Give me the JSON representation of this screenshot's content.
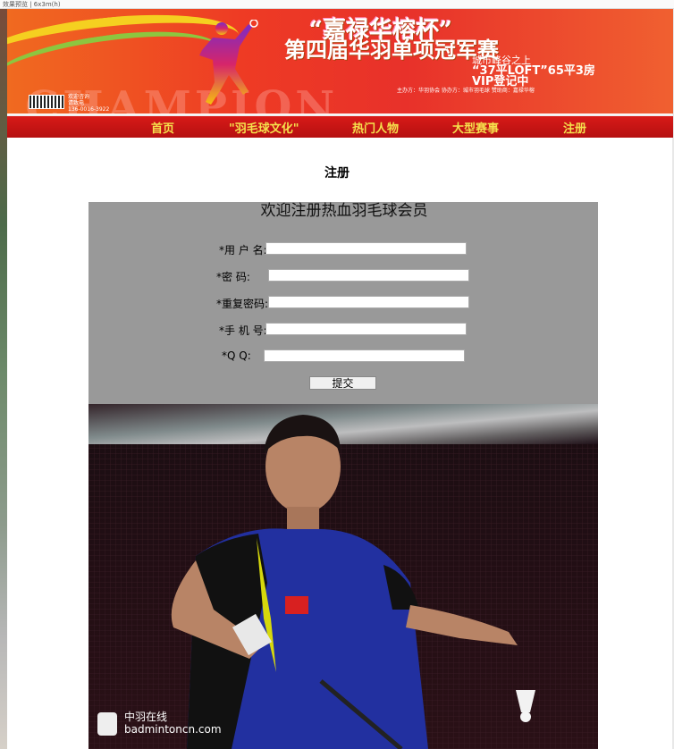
{
  "browser": {
    "tab_text": "效果预览 | 6x3m(h)"
  },
  "banner": {
    "title_line1": "“嘉禄华榕杯”",
    "title_line2": "第四届华羽单项冠军赛",
    "promo_line1": "城市峰谷之上",
    "promo_line2": "“37平LOFT”65平3房",
    "promo_line3": "VIP登记中",
    "watermark_word": "CHAMPION",
    "contact_line1": "欢迎咨询",
    "contact_line2": "请致电",
    "contact_line3": "136-0016-3922",
    "footer_text": "主办方：华羽协会  协办方：城市羽毛球  赞助商：嘉禄华榕"
  },
  "nav": {
    "items": [
      {
        "label": "首页"
      },
      {
        "label": "\"羽毛球文化\""
      },
      {
        "label": "热门人物"
      },
      {
        "label": "大型赛事"
      },
      {
        "label": "注册"
      }
    ]
  },
  "page": {
    "title": "注册"
  },
  "form": {
    "heading": "欢迎注册热血羽毛球会员",
    "fields": [
      {
        "label": "*用 户 名:",
        "value": ""
      },
      {
        "label": "*密    码:",
        "value": ""
      },
      {
        "label": "*重复密码:",
        "value": ""
      },
      {
        "label": "*手 机 号:",
        "value": ""
      },
      {
        "label": "*Q     Q:",
        "value": ""
      }
    ],
    "submit_label": "提交"
  },
  "photo": {
    "watermark_cn": "中羽在线",
    "watermark_url": "badmintoncn.com"
  }
}
